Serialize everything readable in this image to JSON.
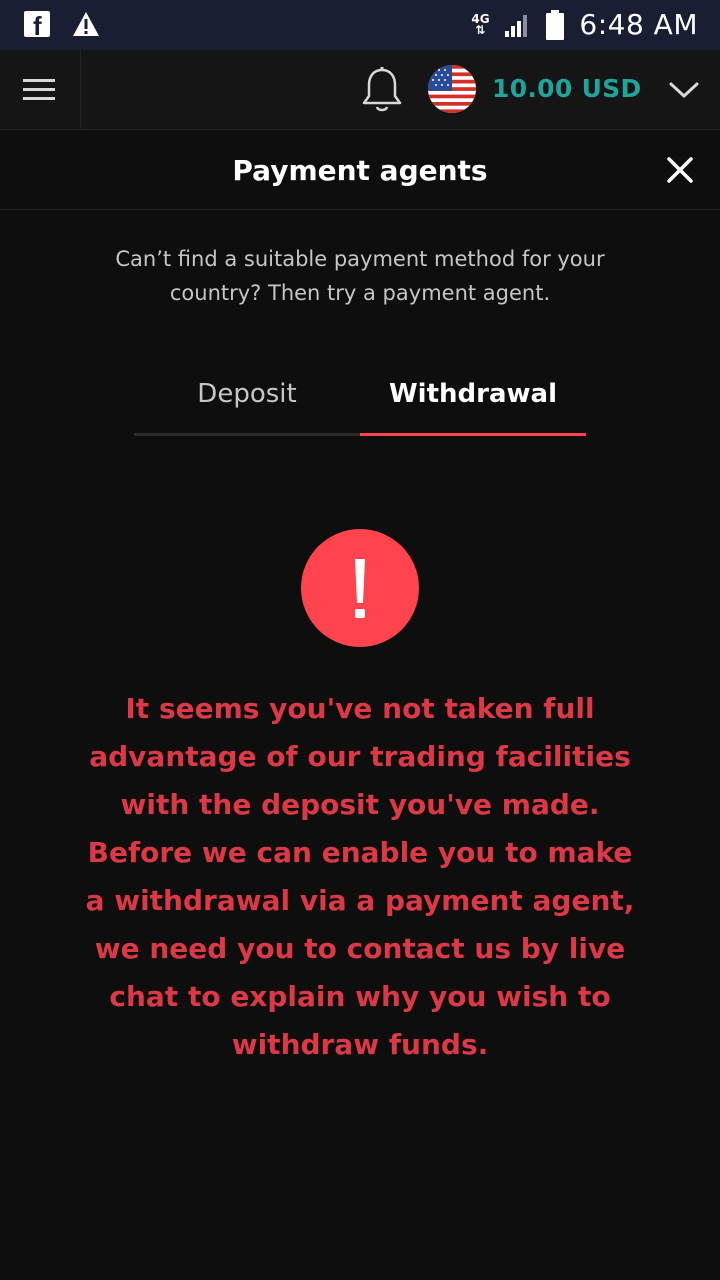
{
  "status_bar": {
    "network": "4G",
    "time": "6:48 AM",
    "icons": [
      "facebook-icon",
      "warning-icon",
      "signal-icon",
      "battery-icon"
    ]
  },
  "app_bar": {
    "balance": "10.00 USD",
    "icons": [
      "menu-icon",
      "bell-icon",
      "us-flag-icon",
      "chevron-down-icon"
    ]
  },
  "modal": {
    "title": "Payment agents",
    "intro": "Can’t find a suitable payment method for your country? Then try a payment agent.",
    "tabs": [
      {
        "label": "Deposit",
        "active": false
      },
      {
        "label": "Withdrawal",
        "active": true
      }
    ],
    "alert_glyph": "!",
    "message": "It seems you've not taken full advantage of our trading facilities with the deposit you've made. Before we can enable you to make a withdrawal via a payment agent, we need you to contact us by live chat to explain why you wish to withdraw funds."
  },
  "colors": {
    "accent_red": "#ff444f",
    "message_red": "#dc3846",
    "balance_teal": "#1fa39a",
    "status_bar_bg": "#1a1e33",
    "background": "#0e0e0e"
  }
}
